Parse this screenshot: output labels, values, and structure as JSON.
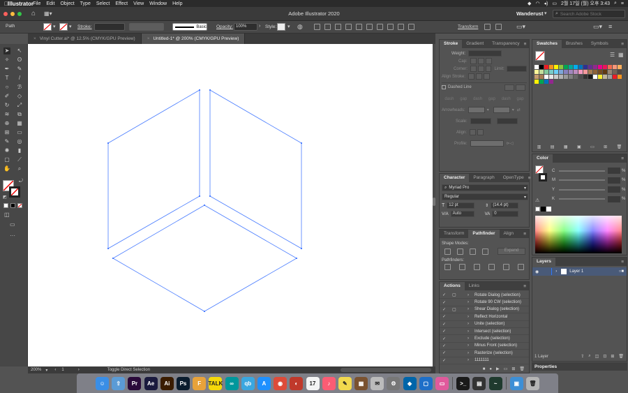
{
  "menubar": {
    "items": [
      "Illustrator",
      "File",
      "Edit",
      "Object",
      "Type",
      "Select",
      "Effect",
      "View",
      "Window",
      "Help"
    ],
    "clock": "2월 17일 (월) 오후 3:43"
  },
  "appbar": {
    "title": "Adobe Illustrator 2020",
    "workspace": "Wanderust",
    "search_placeholder": "Search Adobe Stock"
  },
  "control": {
    "selection_label": "Path",
    "stroke_label": "Stroke:",
    "brush_label": "Basic",
    "opacity_label": "Opacity:",
    "opacity_value": "100%",
    "style_label": "Style:",
    "transform_label": "Transform"
  },
  "tabs": [
    {
      "label": "Vinyl Cutter.ai* @ 12.5% (CMYK/GPU Preview)"
    },
    {
      "label": "Untitled-1* @ 200% (CMYK/GPU Preview)"
    }
  ],
  "status": {
    "zoom": "200%",
    "page": "1",
    "tool": "Toggle Direct Selection"
  },
  "stroke_panel": {
    "tabs": [
      "Stroke",
      "Gradient",
      "Transparency"
    ],
    "weight_label": "Weight:",
    "cap_label": "Cap:",
    "corner_label": "Corner:",
    "limit_label": "Limit:",
    "align_label": "Align Stroke:",
    "dashed_label": "Dashed Line",
    "dash_fields": [
      "dash",
      "gap",
      "dash",
      "gap",
      "dash",
      "gap"
    ],
    "arrowheads_label": "Arrowheads:",
    "scale_label": "Scale:",
    "align2_label": "Align:",
    "profile_label": "Profile:"
  },
  "character_panel": {
    "tabs": [
      "Character",
      "Paragraph",
      "OpenType"
    ],
    "font": "Myriad Pro",
    "style": "Regular",
    "size": "12 pt",
    "leading": "(14.4 pt)",
    "kerning": "Auto",
    "tracking": "0"
  },
  "pathfinder_panel": {
    "tabs": [
      "Transform",
      "Pathfinder",
      "Align"
    ],
    "shape_modes_label": "Shape Modes:",
    "expand_label": "Expand",
    "pathfinders_label": "Pathfinders:"
  },
  "actions_panel": {
    "tabs": [
      "Actions",
      "Links"
    ],
    "items": [
      "Rotate Dialog (selection)",
      "Rotate 90 CW (selection)",
      "Shear Dialog (selection)",
      "Reflect Horizontal",
      "Unite (selection)",
      "Intersect (selection)",
      "Exclude (selection)",
      "Minus Front (selection)",
      "Rasterize (selection)",
      "1111111"
    ]
  },
  "swatches_panel": {
    "tabs": [
      "Swatches",
      "Brushes",
      "Symbols"
    ],
    "colors": [
      "#ffffff",
      "#000000",
      "#ed1c24",
      "#f7941d",
      "#fff200",
      "#8dc63f",
      "#00a651",
      "#00a99d",
      "#00aeef",
      "#0072bc",
      "#2e3192",
      "#662d91",
      "#92278f",
      "#ec008c",
      "#ed145b",
      "#f26c4f",
      "#f7977a",
      "#fbaf5d",
      "#fff799",
      "#c4df9b",
      "#82ca9c",
      "#7accc8",
      "#6dcff6",
      "#7da7d9",
      "#8781bd",
      "#a187be",
      "#bd8cbf",
      "#f49ac1",
      "#f6989d",
      "#a67c52",
      "#8c6239",
      "#754c24",
      "#603913",
      "#998675",
      "#736357",
      "#534741",
      "#c69c6d",
      "#a67c52",
      "#ffffff",
      "#e6e6e6",
      "#cccccc",
      "#b3b3b3",
      "#999999",
      "#808080",
      "#666666",
      "#4d4d4d",
      "#333333",
      "#1a1a1a",
      "#ffffff",
      "#f9ed32",
      "#c2b59b",
      "#9e9e9e",
      "#ed1c24",
      "#f7941d",
      "#fff200",
      "#00a651",
      "#0072bc",
      "#92278f"
    ]
  },
  "color_panel": {
    "title": "Color",
    "channels": [
      "C",
      "M",
      "Y",
      "K"
    ],
    "pct": "%"
  },
  "layers_panel": {
    "title": "Layers",
    "layer_name": "Layer 1",
    "footer": "1 Layer"
  },
  "properties_label": "Properties",
  "dock": [
    {
      "label": "☺",
      "color": "#3a8ee6"
    },
    {
      "label": "⇧",
      "color": "#5b9bd5"
    },
    {
      "label": "Pr",
      "color": "#2a0a3a"
    },
    {
      "label": "Ae",
      "color": "#1a1a3e"
    },
    {
      "label": "Ai",
      "color": "#3a1c00"
    },
    {
      "label": "Ps",
      "color": "#0a1c2e"
    },
    {
      "label": "F",
      "color": "#e8a23a"
    },
    {
      "label": "TALK",
      "color": "#f5d90a"
    },
    {
      "label": "∞",
      "color": "#00979c"
    },
    {
      "label": "qb",
      "color": "#3aa7e0"
    },
    {
      "label": "A",
      "color": "#1e90ff"
    },
    {
      "label": "◉",
      "color": "#dd4b39"
    },
    {
      "label": "◐",
      "color": "#c0392b"
    },
    {
      "label": "17",
      "color": "#f4f4f4"
    },
    {
      "label": "♪",
      "color": "#fb5c74"
    },
    {
      "label": "✎",
      "color": "#f2d94e"
    },
    {
      "label": "▦",
      "color": "#7a5230"
    },
    {
      "label": "✉",
      "color": "#bbbbbb"
    },
    {
      "label": "⚙",
      "color": "#777777"
    },
    {
      "label": "◆",
      "color": "#0065a9"
    },
    {
      "label": "▢",
      "color": "#1e6fc8"
    },
    {
      "label": "▭",
      "color": "#e05a9c"
    },
    {
      "label": ">_",
      "color": "#1a1a1a"
    },
    {
      "label": "▤",
      "color": "#333333"
    },
    {
      "label": "~",
      "color": "#1f3a2e"
    },
    {
      "label": "▣",
      "color": "#3d8fd6"
    },
    {
      "label": "🗑",
      "color": "#b5b5b5"
    }
  ]
}
